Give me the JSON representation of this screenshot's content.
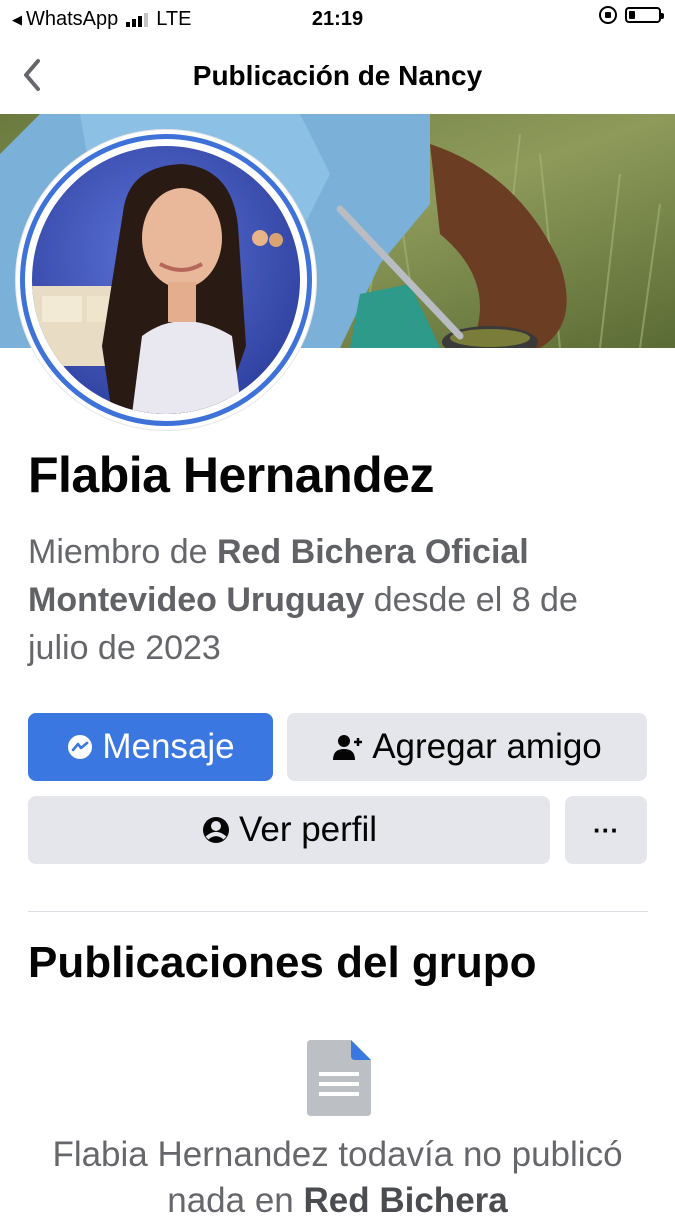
{
  "status_bar": {
    "back_app": "WhatsApp",
    "network": "LTE",
    "time": "21:19",
    "battery_level": 0.2
  },
  "nav": {
    "title": "Publicación de Nancy"
  },
  "profile": {
    "name": "Flabia Hernandez",
    "member_prefix": "Miembro de ",
    "group_name": "Red Bichera Oficial Montevideo Uruguay",
    "member_suffix": " desde el 8 de julio de 2023"
  },
  "actions": {
    "message_label": "Mensaje",
    "add_friend_label": "Agregar amigo",
    "view_profile_label": "Ver perfil",
    "more_label": "···"
  },
  "posts": {
    "section_title": "Publicaciones del grupo",
    "empty_prefix": "Flabia Hernandez todavía no publicó nada en ",
    "empty_group": "Red Bichera"
  },
  "colors": {
    "accent_blue": "#3b77e1",
    "button_gray": "#e4e6eb",
    "secondary_text": "#65676b"
  }
}
